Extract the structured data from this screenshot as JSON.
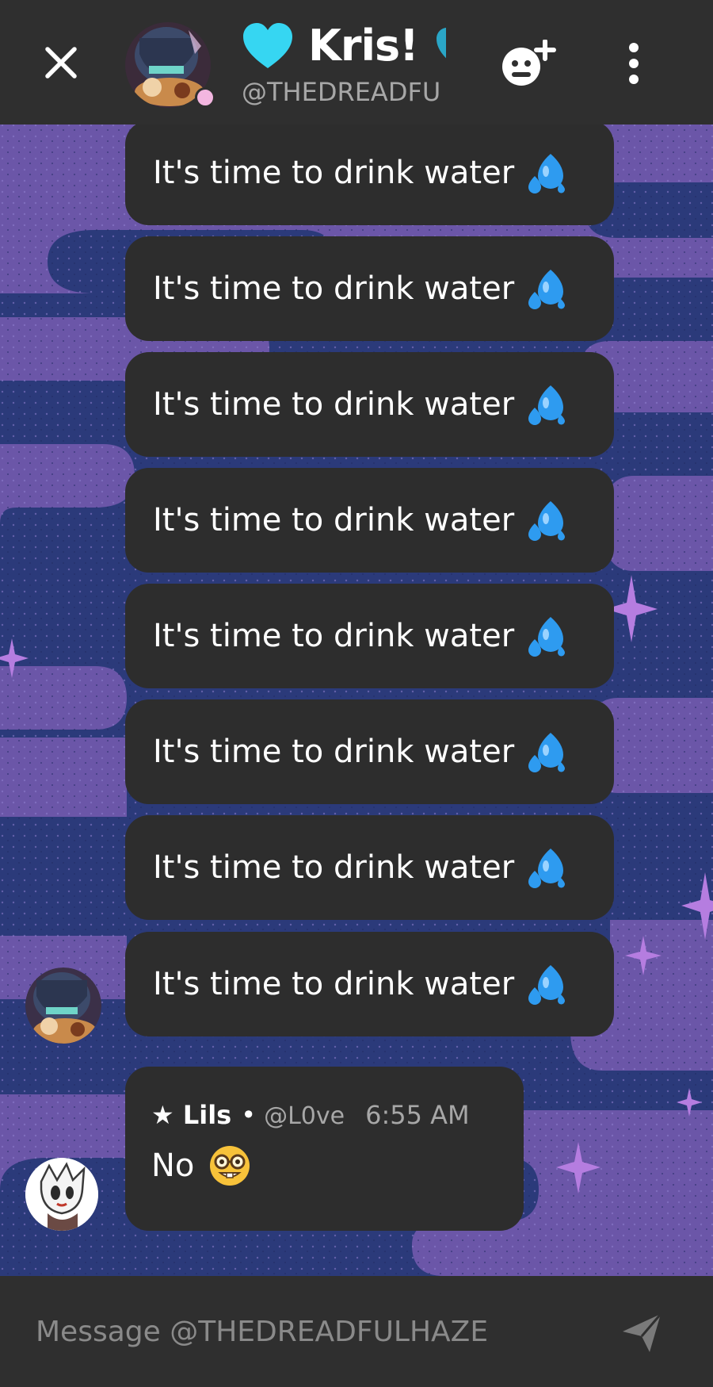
{
  "header": {
    "title": "Kris!",
    "subtitle": "@THEDREADFU",
    "close_icon": "close-icon",
    "add_friend_icon": "emoji-add-icon",
    "more_icon": "more-vertical-icon",
    "title_icon": "blue-heart-icon"
  },
  "messages": [
    {
      "text": "It's time to drink water",
      "emoji": "sweat-droplets-icon"
    },
    {
      "text": "It's time to drink water",
      "emoji": "sweat-droplets-icon"
    },
    {
      "text": "It's time to drink water",
      "emoji": "sweat-droplets-icon"
    },
    {
      "text": "It's time to drink water",
      "emoji": "sweat-droplets-icon"
    },
    {
      "text": "It's time to drink water",
      "emoji": "sweat-droplets-icon"
    },
    {
      "text": "It's time to drink water",
      "emoji": "sweat-droplets-icon"
    },
    {
      "text": "It's time to drink water",
      "emoji": "sweat-droplets-icon"
    },
    {
      "text": "It's time to drink water",
      "emoji": "sweat-droplets-icon"
    }
  ],
  "reply": {
    "name": "★ Lils",
    "separator": "•",
    "handle": "@L0ve",
    "time": "6:55 AM",
    "text": "No",
    "emoji": "nerd-face-icon"
  },
  "composer": {
    "placeholder": "Message @THEDREADFULHAZE",
    "send_icon": "send-icon"
  },
  "colors": {
    "header_bg": "#2f2f2f",
    "bubble_bg": "#2d2d2d",
    "muted_text": "#a7a7a7",
    "heart_cyan": "#36d6f2",
    "bg_navy": "#2b3a7a",
    "bg_purple": "#6b56a8"
  }
}
